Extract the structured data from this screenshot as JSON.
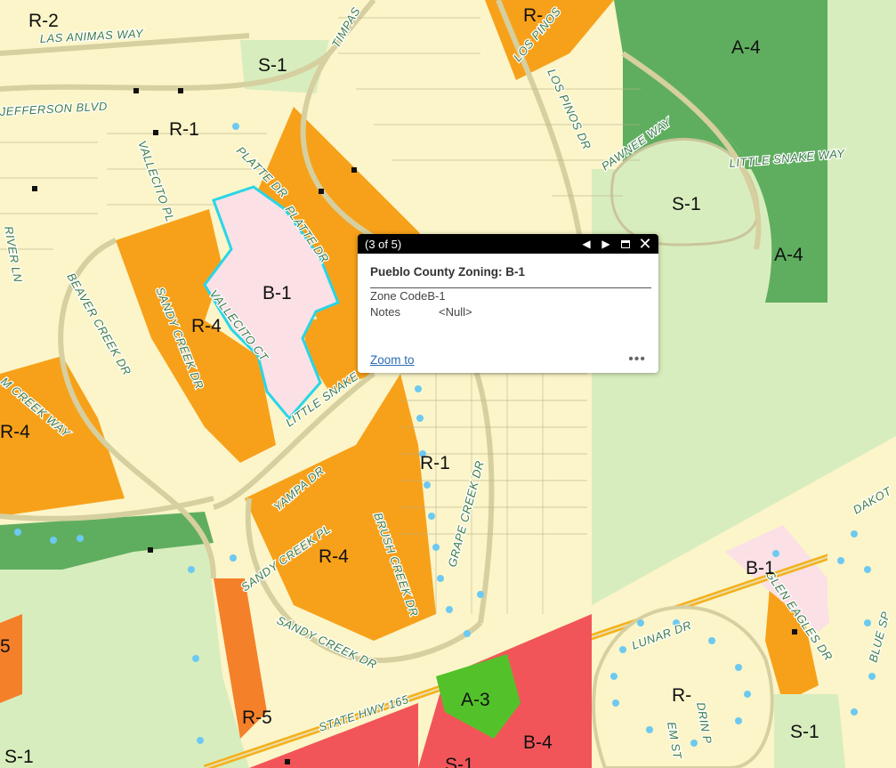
{
  "colors": {
    "r1": "#fbf5c9",
    "r4": "#f7a11a",
    "b1": "#fbe0e6",
    "s1": "#d8edbd",
    "a4": "#5fae5f",
    "a3": "#53c22a",
    "b4": "#f25559",
    "r5": "#f5802a",
    "highlight": "#27d6e6",
    "street_label": "#3c7a4a",
    "popup_header": "#000000",
    "link": "#2a6ab2"
  },
  "zones": {
    "r2": "R-2",
    "r1_a": "R-1",
    "r1_b": "R-1",
    "r1_c": "R-1",
    "r4_a": "R-4",
    "r4_b": "R-4",
    "r4_c": "R-4",
    "s1_a": "S-1",
    "s1_b": "S-1",
    "s1_c": "S-1",
    "s1_d": "S-1",
    "s1_e": "S-1",
    "a4_a": "A-4",
    "a4_b": "A-4",
    "b1_a": "B-1",
    "b1_b": "B-1",
    "a3": "A-3",
    "b4": "B-4",
    "r5": "R-5",
    "r_partial": "R-",
    "five_partial": "5",
    "r_top_partial": "R-"
  },
  "streets": {
    "las_animas": "LAS ANIMAS WAY",
    "jefferson": "JEFFERSON BLVD",
    "timpas": "TIMPAS",
    "los_pinos_top": "LOS PINOS",
    "los_pinos_dr": "LOS PINOS DR",
    "pawnee": "PAWNEE WAY",
    "little_snake_way": "LITTLE SNAKE WAY",
    "vallecito_pl": "VALLECITO PL",
    "platte_dr_a": "PLATTE DR",
    "platte_dr_b": "PLATTE DR",
    "beaver_creek": "BEAVER CREEK DR",
    "sandy_creek_dr": "SANDY CREEK DR",
    "vallecito_ct": "VALLECITO CT",
    "little_snake": "LITTLE SNAKE",
    "river_ln": "RIVER LN",
    "creek_way": "M CREEK WAY",
    "yampa": "YAMPA DR",
    "sandy_creek_pl": "SANDY CREEK PL",
    "brush_creek": "BRUSH CREEK DR",
    "grape_creek": "GRAPE CREEK DR",
    "sandy_creek_dr_b": "SANDY CREEK DR",
    "state_hwy": "STATE HWY 165",
    "lunar": "LUNAR DR",
    "glen_eagles": "GLEN EAGLES DR",
    "dakota": "DAKOT",
    "blue": "BLUE SP",
    "drin": "DRIN P",
    "em_st": "EM ST"
  },
  "popup": {
    "counter": "(3 of 5)",
    "title": "Pueblo County Zoning: B-1",
    "zone_code_label": "Zone Code",
    "zone_code_value": "B-1",
    "notes_label": "Notes",
    "notes_value": "<Null>",
    "zoom_label": "Zoom to",
    "more_label": "•••",
    "prev_icon": "previous-arrow",
    "next_icon": "next-arrow",
    "maximize_icon": "maximize",
    "close_icon": "close"
  }
}
